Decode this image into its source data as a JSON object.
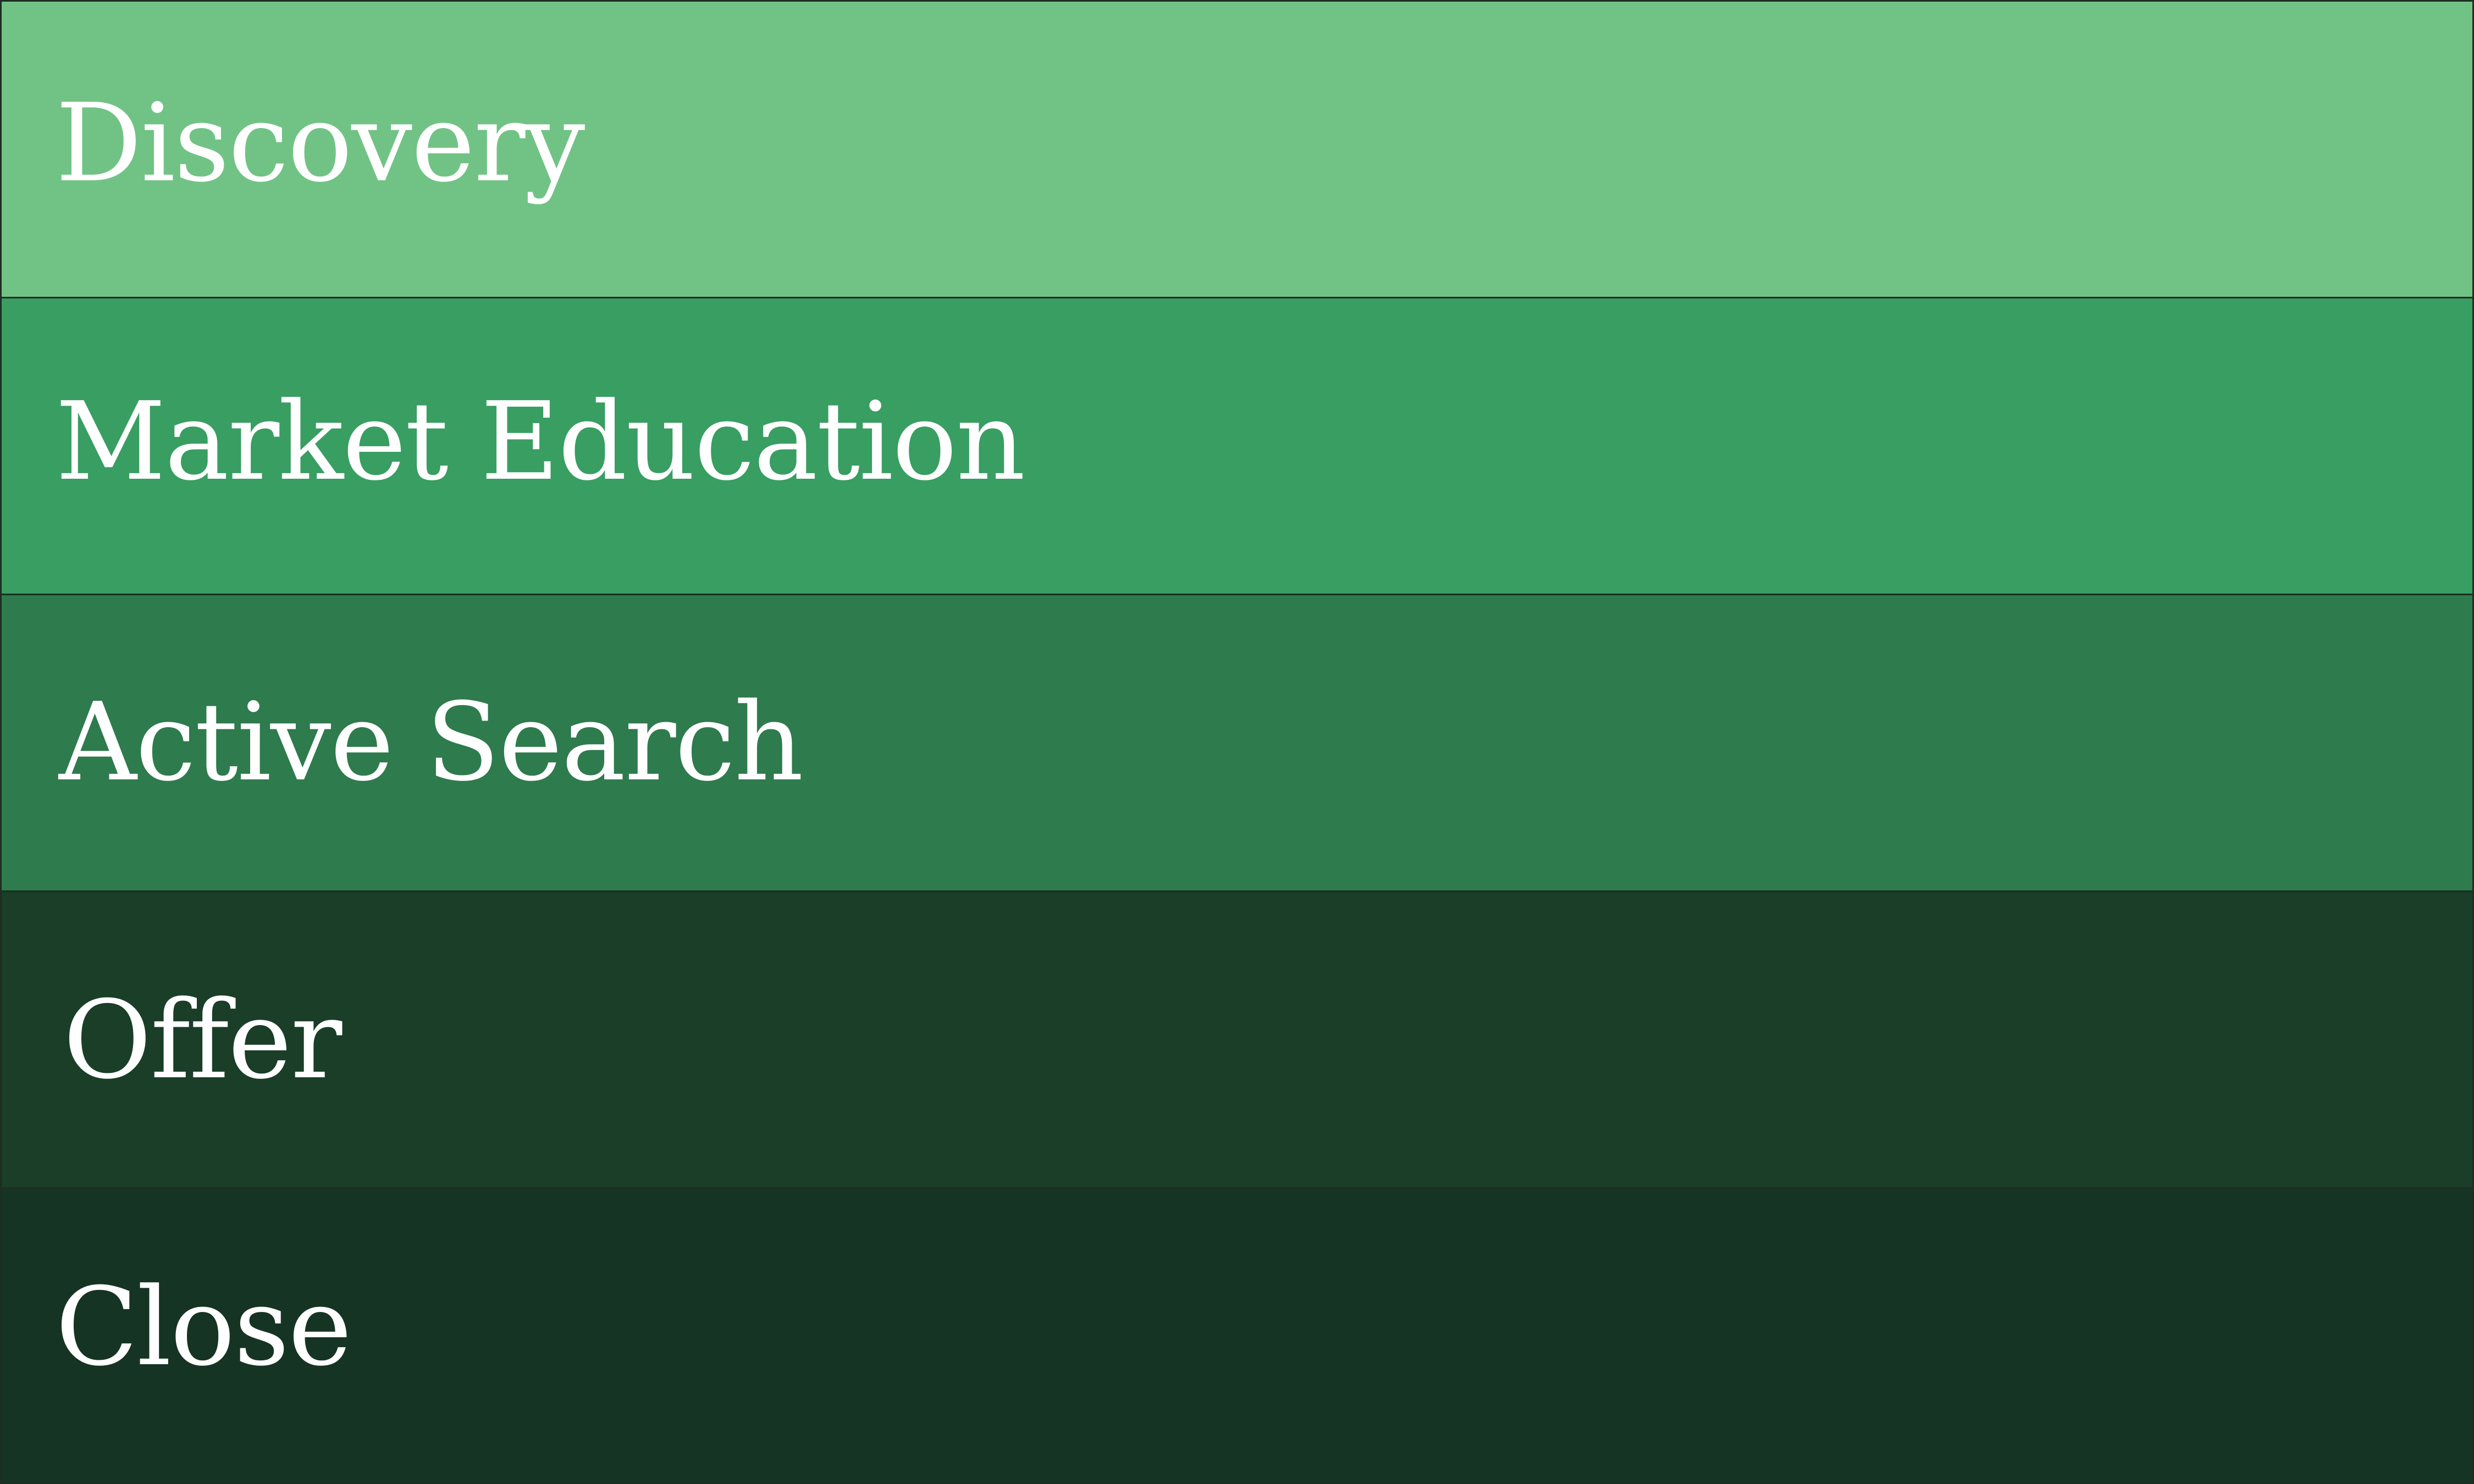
{
  "stages": [
    {
      "label": "Discovery",
      "color": "#71c385"
    },
    {
      "label": "Market Education",
      "color": "#389e62"
    },
    {
      "label": "Active Search",
      "color": "#2e7b4d"
    },
    {
      "label": "Offer",
      "color": "#1a3e28"
    },
    {
      "label": "Close",
      "color": "#163424"
    }
  ]
}
